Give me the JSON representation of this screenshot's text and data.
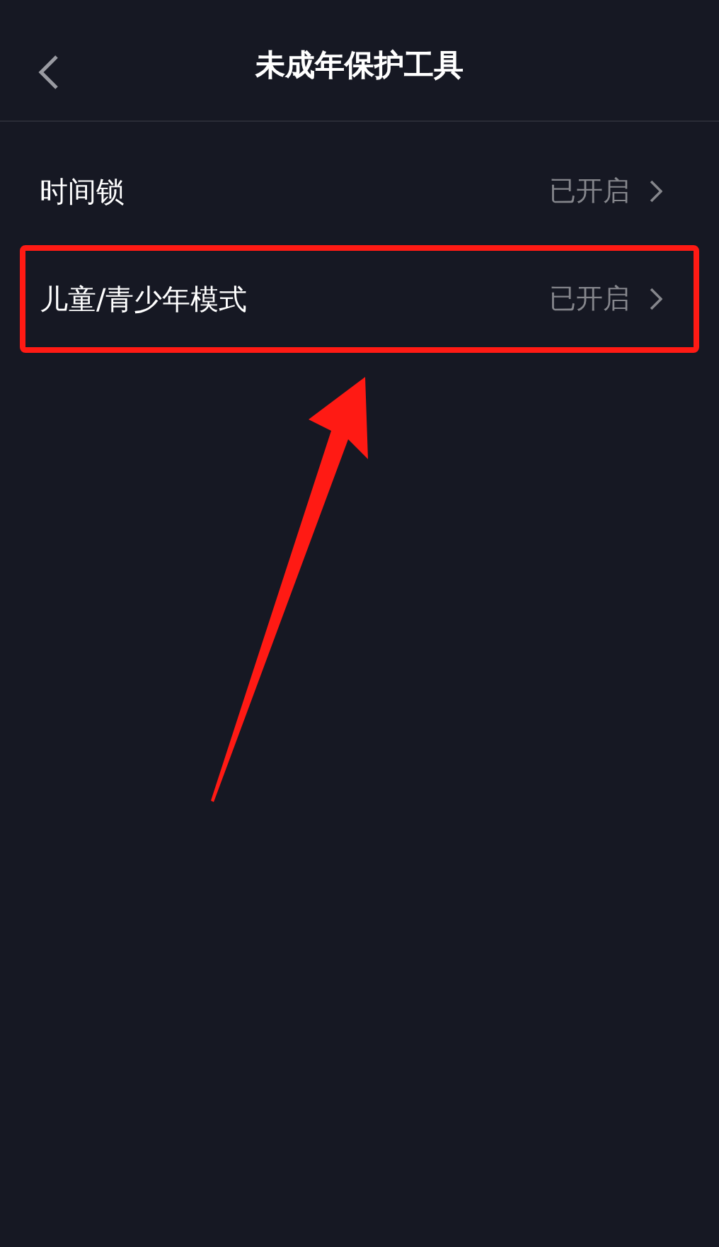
{
  "nav": {
    "title": "未成年保护工具"
  },
  "items": [
    {
      "label": "时间锁",
      "value": "已开启",
      "highlighted": false
    },
    {
      "label": "儿童/青少年模式",
      "value": "已开启",
      "highlighted": true
    }
  ]
}
